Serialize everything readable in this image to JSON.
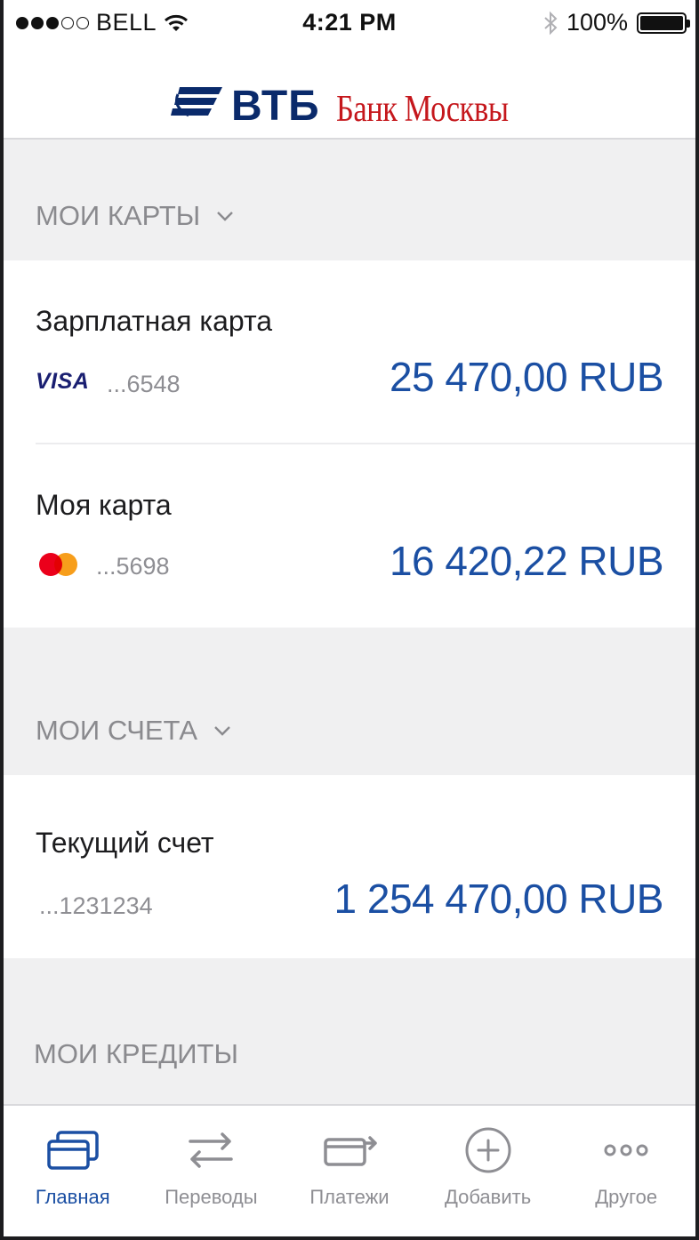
{
  "status_bar": {
    "carrier": "BELL",
    "time": "4:21 PM",
    "battery": "100%"
  },
  "header": {
    "logo_main": "ВТБ",
    "logo_sub": "Банк Москвы"
  },
  "sections": {
    "cards": {
      "label": "МОИ КАРТЫ",
      "items": [
        {
          "title": "Зарплатная  карта",
          "brand": "VISA",
          "number": "...6548",
          "amount": "25 470,00 RUB"
        },
        {
          "title": "Моя карта",
          "brand": "mastercard-icon",
          "number": "...5698",
          "amount": "16 420,22 RUB"
        }
      ]
    },
    "accounts": {
      "label": "МОИ СЧЕТА",
      "items": [
        {
          "title": "Текущий счет",
          "number": "...1231234",
          "amount": "1 254 470,00 RUB"
        }
      ]
    },
    "credits": {
      "label": "МОИ КРЕДИТЫ"
    }
  },
  "tabbar": {
    "tabs": [
      {
        "label": "Главная",
        "icon": "cards-icon",
        "active": true
      },
      {
        "label": "Переводы",
        "icon": "transfer-arrows-icon",
        "active": false
      },
      {
        "label": "Платежи",
        "icon": "payment-card-arrow-icon",
        "active": false
      },
      {
        "label": "Добавить",
        "icon": "add-circle-icon",
        "active": false
      },
      {
        "label": "Другое",
        "icon": "more-dots-icon",
        "active": false
      }
    ]
  },
  "colors": {
    "accent": "#1b4fa3",
    "brand_blue": "#0a2a6b",
    "brand_red": "#c5171c",
    "section_bg": "#f0f0f1"
  }
}
